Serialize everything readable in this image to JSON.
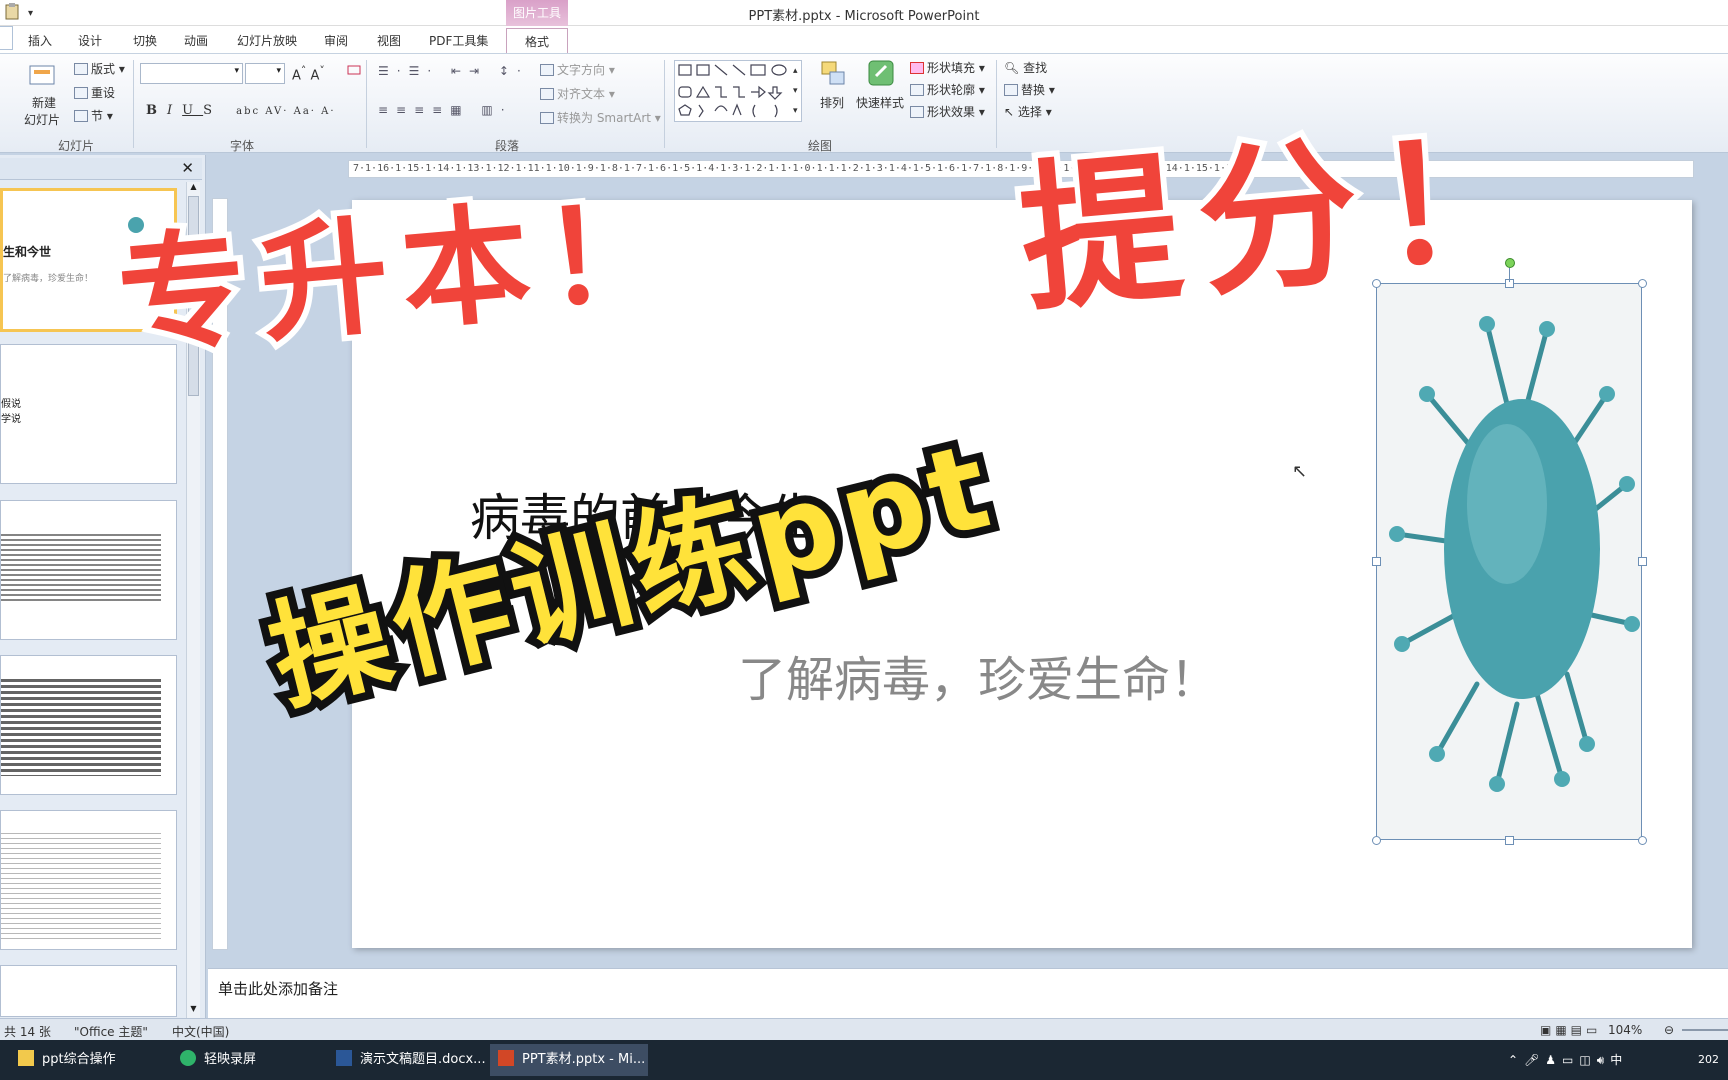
{
  "window": {
    "title": "PPT素材.pptx - Microsoft PowerPoint"
  },
  "context_group": {
    "label": "图片工具"
  },
  "tabs": [
    {
      "label": "插入"
    },
    {
      "label": "设计"
    },
    {
      "label": "切换"
    },
    {
      "label": "动画"
    },
    {
      "label": "幻灯片放映"
    },
    {
      "label": "审阅"
    },
    {
      "label": "视图"
    },
    {
      "label": "PDF工具集"
    },
    {
      "label": "格式"
    }
  ],
  "ribbon": {
    "slides": {
      "new_slide": "新建",
      "new_slide2": "幻灯片",
      "layout": "版式",
      "reset": "重设",
      "section": "节",
      "group": "幻灯片"
    },
    "font": {
      "group": "字体"
    },
    "paragraph": {
      "text_direction": "文字方向",
      "align_text": "对齐文本",
      "smartart": "转换为 SmartArt",
      "group": "段落"
    },
    "drawing": {
      "arrange": "排列",
      "quick_styles": "快速样式",
      "fill": "形状填充",
      "outline": "形状轮廓",
      "effects": "形状效果",
      "group": "绘图"
    },
    "editing": {
      "find": "查找",
      "replace": "替换",
      "select": "选择"
    }
  },
  "panel": {
    "close": "✕",
    "thumb1_title": "生和今世",
    "thumb1_sub": "了解病毒，珍爱生命！",
    "thumb2_l1": "假说",
    "thumb2_l2": "学说"
  },
  "ruler": {
    "text": "7·1·16·1·15·1·14·1·13·1·12·1·11·1·10·1·9·1·8·1·7·1·6·1·5·1·4·1·3·1·2·1·1·1·0·1·1·1·2·1·3·1·4·1·5·1·6·1·7·1·8·1·9·1·10·1·11·1·12·1·13·1·14·1·15·1·16·1"
  },
  "slide": {
    "title": "病毒的前世今生",
    "subtitle": "了解病毒，珍爱生命！"
  },
  "notes": {
    "placeholder": "单击此处添加备注"
  },
  "status": {
    "slide_count": "共 14 张",
    "theme": "\"Office 主题\"",
    "language": "中文(中国)",
    "zoom": "104%"
  },
  "taskbar": [
    {
      "label": "ppt综合操作"
    },
    {
      "label": "轻映录屏"
    },
    {
      "label": "演示文稿题目.docx..."
    },
    {
      "label": "PPT素材.pptx - Mi..."
    }
  ],
  "tray": {
    "ime": "中",
    "year": "202"
  },
  "overlay": {
    "line1": "专升本！",
    "line2": "提分！",
    "line3": "操作训练ppt"
  }
}
